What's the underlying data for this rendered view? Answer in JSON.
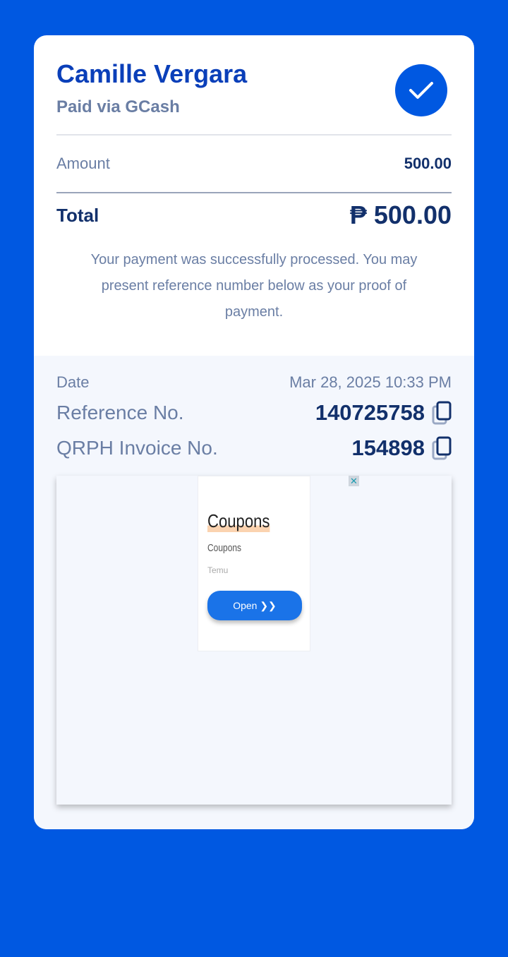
{
  "payer": {
    "name": "Camille Vergara",
    "method": "Paid via GCash"
  },
  "amount": {
    "label": "Amount",
    "value": "500.00"
  },
  "total": {
    "label": "Total",
    "value": "₱ 500.00"
  },
  "message": "Your payment was successfully processed. You may present reference number below as your proof of payment.",
  "details": {
    "date_label": "Date",
    "date_value": "Mar 28, 2025 10:33 PM",
    "ref_label": "Reference No.",
    "ref_value": "140725758",
    "invoice_label": "QRPH Invoice No.",
    "invoice_value": "154898"
  },
  "ad": {
    "title": "Coupons",
    "subtitle": "Coupons",
    "brand": "Temu",
    "button": "Open  ❯❯",
    "close": "✕"
  }
}
